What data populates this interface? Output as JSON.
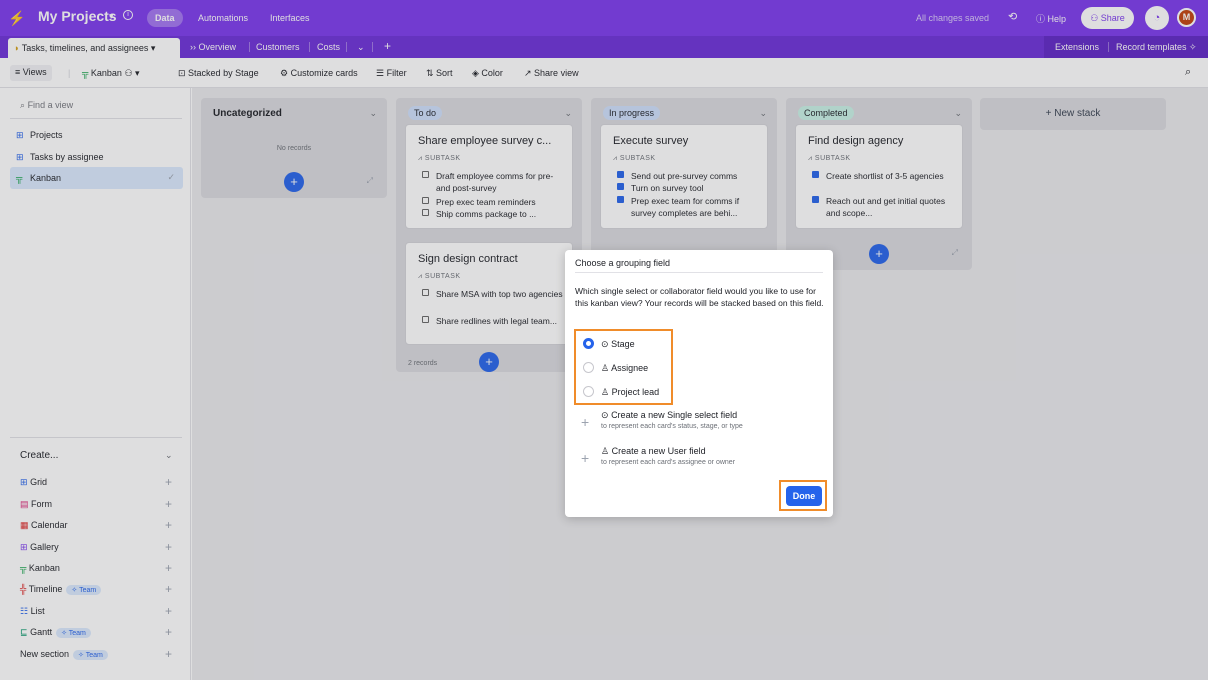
{
  "topbar": {
    "base_name": "My Projects",
    "tabs": [
      "Data",
      "Automations",
      "Interfaces"
    ],
    "saved_status": "All changes saved",
    "help": "Help",
    "share": "Share",
    "avatar": "M",
    "accent": "#7c39ed"
  },
  "tablebar": {
    "active_table": "Tasks, timelines, and assignees",
    "tables": [
      "Overview",
      "Customers",
      "Costs"
    ],
    "extensions": "Extensions",
    "record_templates": "Record templates"
  },
  "viewbar": {
    "views": "Views",
    "current_view": "Kanban",
    "stacked_by": "Stacked by Stage",
    "customize": "Customize cards",
    "filter": "Filter",
    "sort": "Sort",
    "color": "Color",
    "share_view": "Share view"
  },
  "sidebar": {
    "find_placeholder": "Find a view",
    "views": [
      {
        "label": "Projects",
        "icon": "grid-icon"
      },
      {
        "label": "Tasks by assignee",
        "icon": "grid-icon"
      },
      {
        "label": "Kanban",
        "icon": "kanban-icon",
        "selected": true
      }
    ],
    "create_header": "Create...",
    "create_items": [
      {
        "label": "Grid",
        "icon": "grid-icon"
      },
      {
        "label": "Form",
        "icon": "form-icon"
      },
      {
        "label": "Calendar",
        "icon": "calendar-icon"
      },
      {
        "label": "Gallery",
        "icon": "gallery-icon"
      },
      {
        "label": "Kanban",
        "icon": "kanban-icon"
      },
      {
        "label": "Timeline",
        "icon": "timeline-icon",
        "badge": "Team"
      },
      {
        "label": "List",
        "icon": "list-icon"
      },
      {
        "label": "Gantt",
        "icon": "gantt-icon",
        "badge": "Team"
      },
      {
        "label": "New section",
        "badge": "Team"
      }
    ]
  },
  "board": {
    "stacks": [
      {
        "name": "Uncategorized",
        "empty_text": "No records"
      },
      {
        "name": "To do",
        "color": "#cfe0fc",
        "footer": "2 records"
      },
      {
        "name": "In progress",
        "color": "#cfe0fc"
      },
      {
        "name": "Completed",
        "color": "#c9f2e6"
      }
    ],
    "new_stack": "+ New stack",
    "subtask_label": "SUBTASK",
    "cards": {
      "todo_1": {
        "title": "Share employee survey c...",
        "items": [
          "Draft employee comms for pre- and post-survey",
          "Prep exec team reminders",
          "Ship comms package to ..."
        ]
      },
      "todo_2": {
        "title": "Sign design contract",
        "items": [
          "Share MSA with top two agencies",
          "Share redlines with legal team..."
        ]
      },
      "inprog_1": {
        "title": "Execute survey",
        "items": [
          "Send out pre-survey comms",
          "Turn on survey tool",
          "Prep exec team for comms if survey completes are behi..."
        ]
      },
      "done_1": {
        "title": "Find design agency",
        "items": [
          "Create shortlist of 3-5 agencies",
          "Reach out and get initial quotes and scope..."
        ]
      }
    }
  },
  "modal": {
    "title": "Choose a grouping field",
    "description": "Which single select or collaborator field would you like to use for this kanban view? Your records will be stacked based on this field.",
    "options": [
      "Stage",
      "Assignee",
      "Project lead"
    ],
    "selected": "Stage",
    "create_single_select": "Create a new Single select field",
    "create_single_select_sub": "to represent each card's status, stage, or type",
    "create_user": "Create a new User field",
    "create_user_sub": "to represent each card's assignee or owner",
    "done": "Done"
  }
}
